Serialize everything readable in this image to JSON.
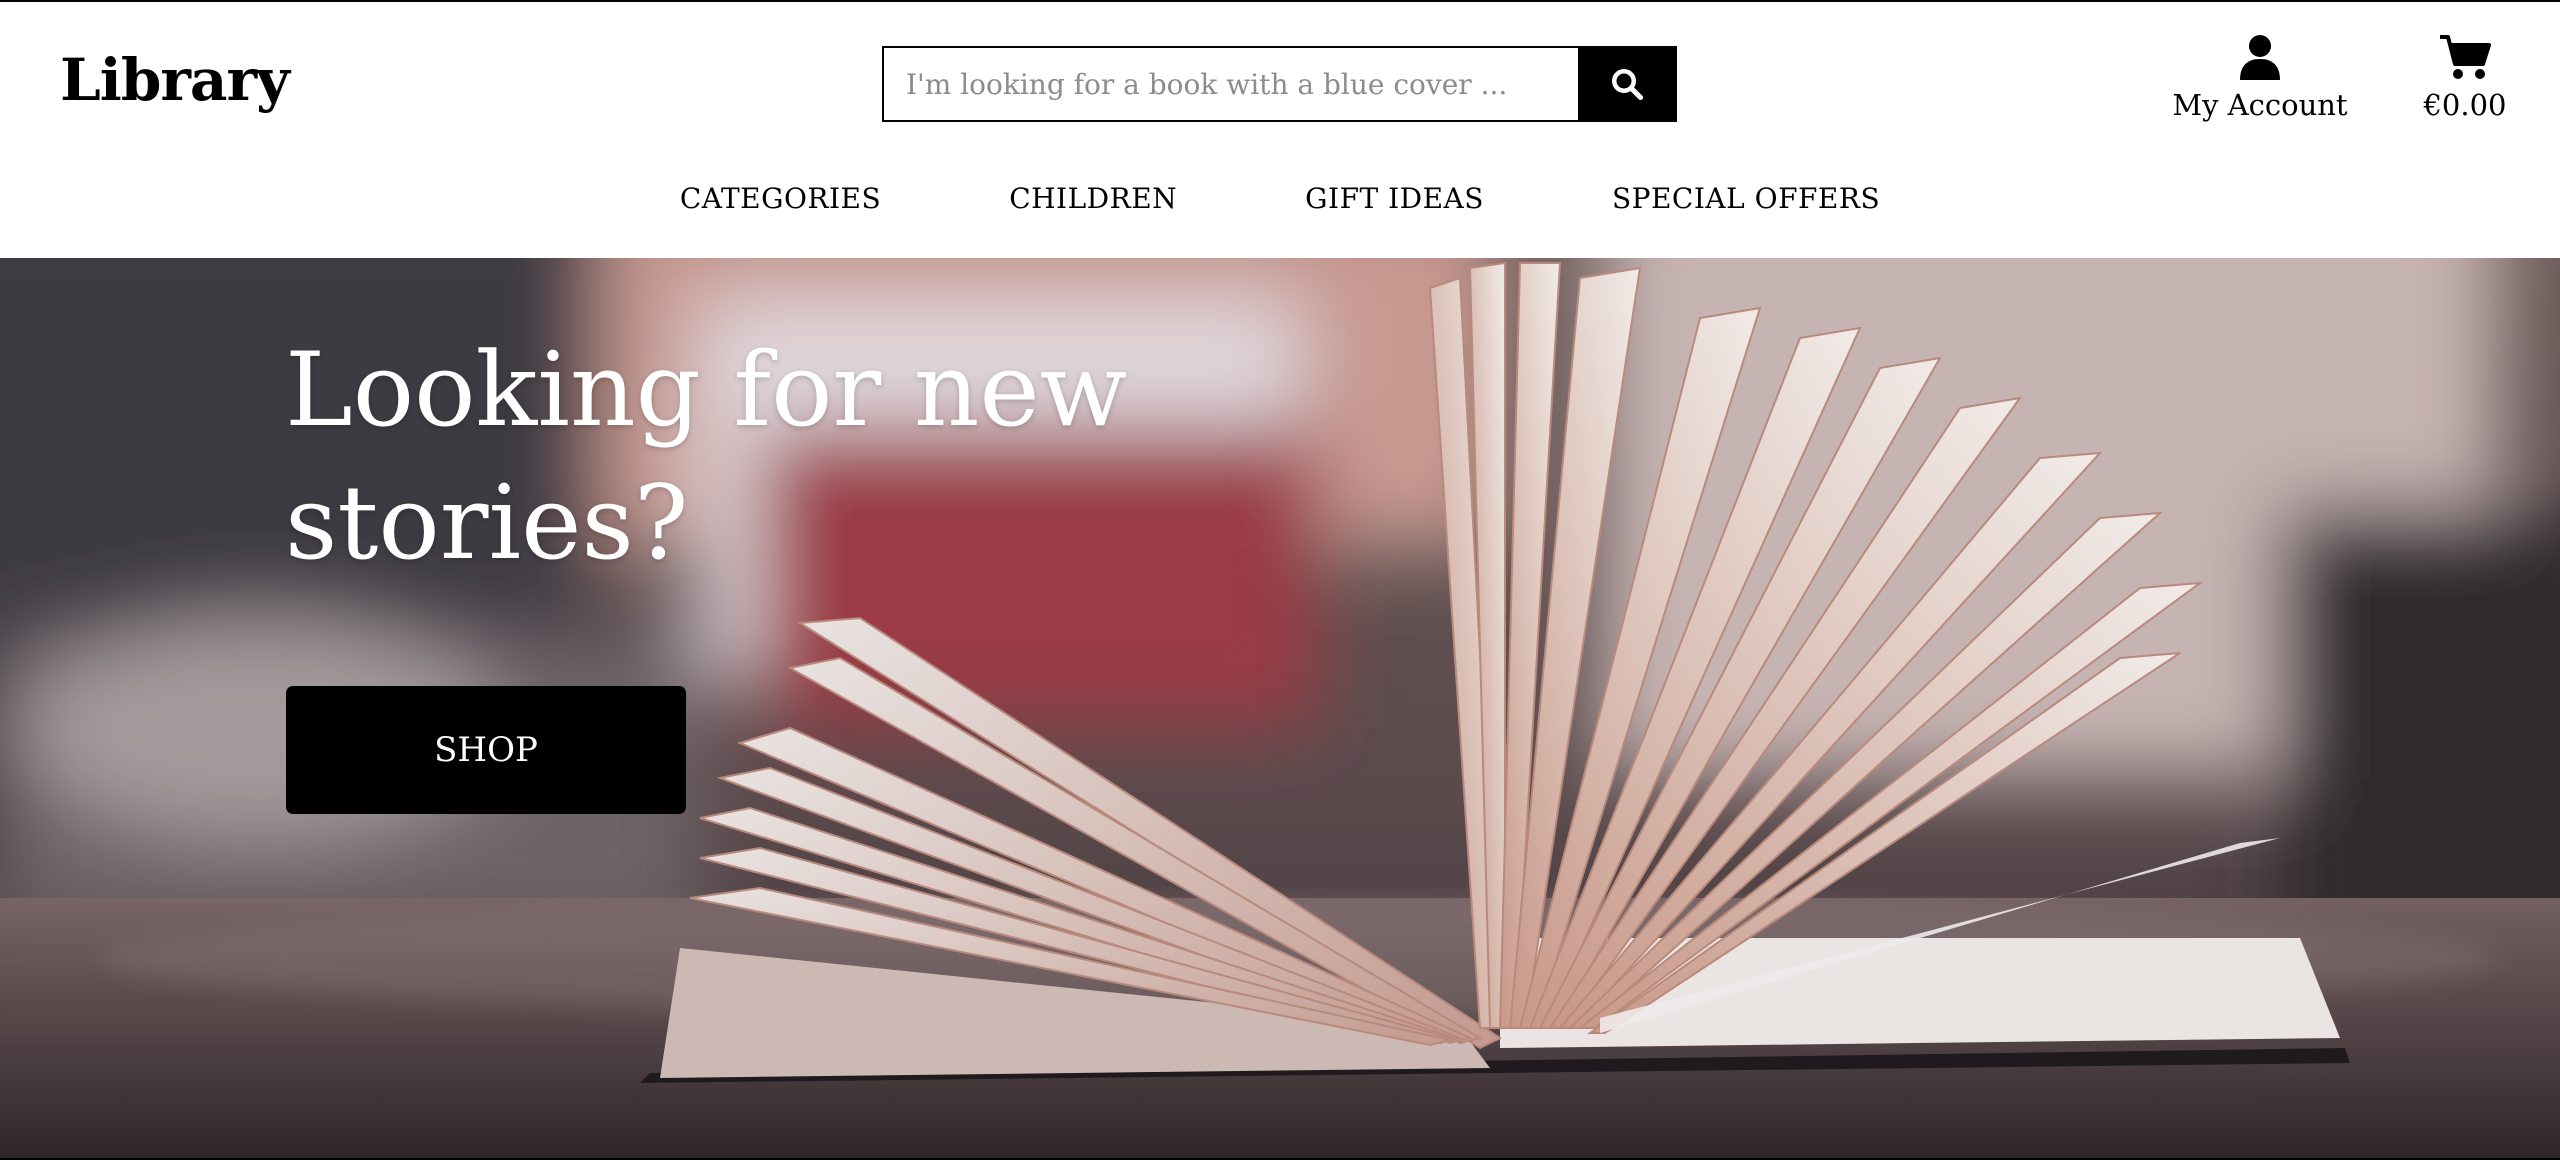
{
  "header": {
    "brand": "Library",
    "search": {
      "placeholder": "I'm looking for a book with a blue cover ..."
    },
    "search_button_icon": "search-icon",
    "account": {
      "icon": "user-icon",
      "label": "My Account"
    },
    "cart": {
      "icon": "cart-icon",
      "label": "€0.00"
    }
  },
  "nav": {
    "items": [
      {
        "label": "CATEGORIES"
      },
      {
        "label": "CHILDREN"
      },
      {
        "label": "GIFT IDEAS"
      },
      {
        "label": "SPECIAL OFFERS"
      }
    ]
  },
  "hero": {
    "title": "Looking for new stories?",
    "cta_label": "SHOP",
    "background_image": "open book with fanned pages on a wooden table"
  },
  "colors": {
    "accent": "#000000",
    "background": "#ffffff",
    "hero_text": "#ffffff"
  }
}
